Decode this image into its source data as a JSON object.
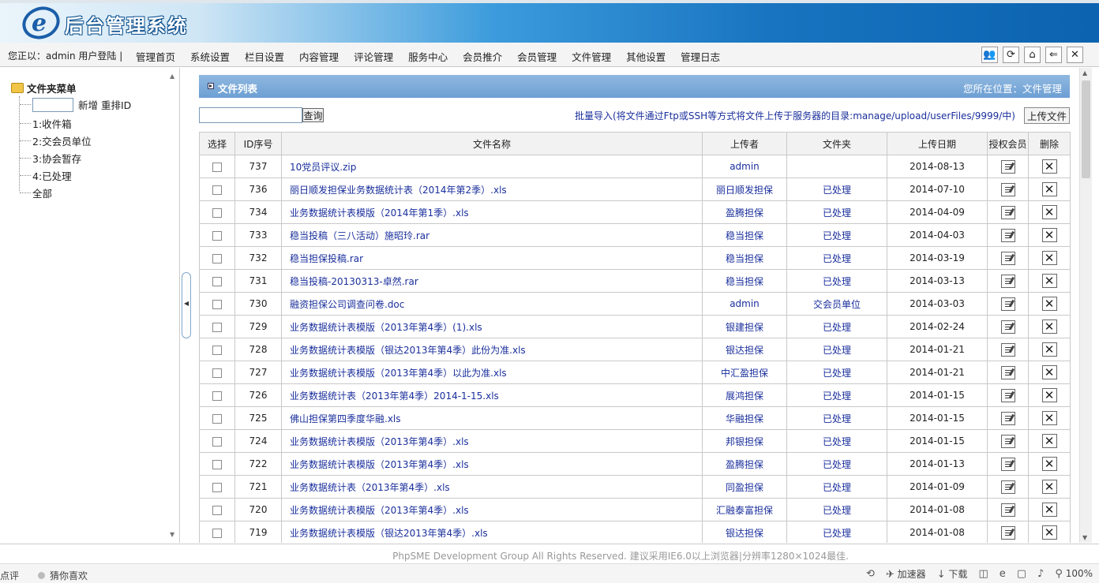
{
  "header": {
    "title": "后台管理系统"
  },
  "nav": {
    "login_status": "您正以：admin 用户登陆 |",
    "items": [
      "管理首页",
      "系统设置",
      "栏目设置",
      "内容管理",
      "评论管理",
      "服务中心",
      "会员推介",
      "会员管理",
      "文件管理",
      "其他设置",
      "管理日志"
    ]
  },
  "sidebar": {
    "root_label": "文件夹菜单",
    "new_reorder": "新增 重排ID",
    "folders": [
      "1:收件箱",
      "2:交会员单位",
      "3:协会暂存",
      "4:已处理",
      "全部"
    ]
  },
  "main": {
    "title": "文件列表",
    "location": "您所在位置：文件管理",
    "search_button": "查询",
    "batch_note": "批量导入(将文件通过Ftp或SSH等方式将文件上传于服务器的目录:manage/upload/userFiles/9999/中)",
    "upload_button": "上传文件"
  },
  "table": {
    "headers": [
      "选择",
      "ID序号",
      "文件名称",
      "上传者",
      "文件夹",
      "上传日期",
      "授权会员",
      "删除"
    ],
    "rows": [
      {
        "id": "737",
        "name": "10党员评议.zip",
        "uploader": "admin",
        "folder": "",
        "date": "2014-08-13"
      },
      {
        "id": "736",
        "name": "丽日顺发担保业务数据统计表（2014年第2季）.xls",
        "uploader": "丽日顺发担保",
        "folder": "已处理",
        "date": "2014-07-10"
      },
      {
        "id": "734",
        "name": "业务数据统计表模版（2014年第1季）.xls",
        "uploader": "盈腾担保",
        "folder": "已处理",
        "date": "2014-04-09"
      },
      {
        "id": "733",
        "name": "稳当投稿（三八活动）施昭玲.rar",
        "uploader": "稳当担保",
        "folder": "已处理",
        "date": "2014-04-03"
      },
      {
        "id": "732",
        "name": "稳当担保投稿.rar",
        "uploader": "稳当担保",
        "folder": "已处理",
        "date": "2014-03-19"
      },
      {
        "id": "731",
        "name": "稳当投稿-20130313-卓然.rar",
        "uploader": "稳当担保",
        "folder": "已处理",
        "date": "2014-03-13"
      },
      {
        "id": "730",
        "name": "融资担保公司调查问卷.doc",
        "uploader": "admin",
        "folder": "交会员单位",
        "date": "2014-03-03"
      },
      {
        "id": "729",
        "name": "业务数据统计表模版（2013年第4季）(1).xls",
        "uploader": "银建担保",
        "folder": "已处理",
        "date": "2014-02-24"
      },
      {
        "id": "728",
        "name": "业务数据统计表模版（银达2013年第4季）此份为准.xls",
        "uploader": "银达担保",
        "folder": "已处理",
        "date": "2014-01-21"
      },
      {
        "id": "727",
        "name": "业务数据统计表模版（2013年第4季）以此为准.xls",
        "uploader": "中汇盈担保",
        "folder": "已处理",
        "date": "2014-01-21"
      },
      {
        "id": "726",
        "name": "业务数据统计表（2013年第4季）2014-1-15.xls",
        "uploader": "展鸿担保",
        "folder": "已处理",
        "date": "2014-01-15"
      },
      {
        "id": "725",
        "name": "佛山担保第四季度华融.xls",
        "uploader": "华融担保",
        "folder": "已处理",
        "date": "2014-01-15"
      },
      {
        "id": "724",
        "name": "业务数据统计表模版（2013年第4季）.xls",
        "uploader": "邦银担保",
        "folder": "已处理",
        "date": "2014-01-15"
      },
      {
        "id": "722",
        "name": "业务数据统计表模版（2013年第4季）.xls",
        "uploader": "盈腾担保",
        "folder": "已处理",
        "date": "2014-01-13"
      },
      {
        "id": "721",
        "name": "业务数据统计表（2013年第4季）.xls",
        "uploader": "同盈担保",
        "folder": "已处理",
        "date": "2014-01-09"
      },
      {
        "id": "720",
        "name": "业务数据统计表模版（2013年第4季）.xls",
        "uploader": "汇融泰富担保",
        "folder": "已处理",
        "date": "2014-01-08"
      },
      {
        "id": "719",
        "name": "业务数据统计表模版（银达2013年第4季）.xls",
        "uploader": "银达担保",
        "folder": "已处理",
        "date": "2014-01-08"
      }
    ]
  },
  "footer": {
    "copyright": "PhpSME Development Group All Rights Reserved.",
    "advice": "建议采用IE6.0以上浏览器|分辨率1280×1024最佳."
  },
  "statusbar": {
    "left": "点评",
    "guess": "猜你喜欢",
    "accelerator": "加速器",
    "download": "下载",
    "zoom": "100%"
  }
}
